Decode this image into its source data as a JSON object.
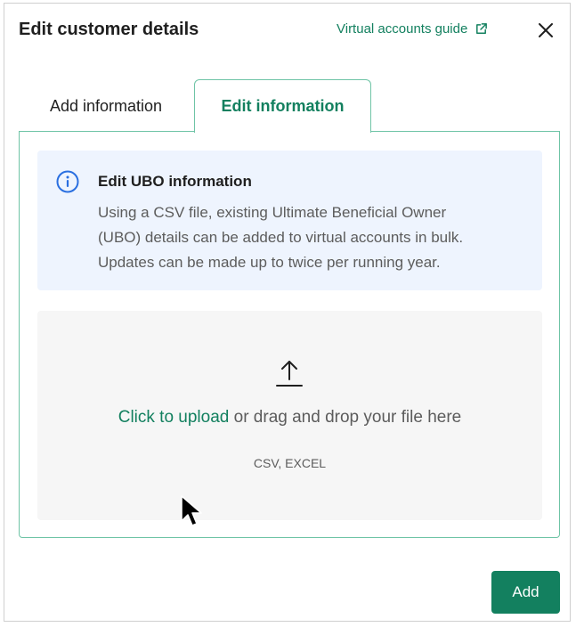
{
  "modal": {
    "title": "Edit customer details",
    "guide_link": "Virtual accounts guide",
    "guide_icon": "external-link-icon",
    "close_icon": "close-icon"
  },
  "tabs": [
    {
      "label": "Add information",
      "active": false
    },
    {
      "label": "Edit information",
      "active": true
    }
  ],
  "info": {
    "icon": "info-icon",
    "title": "Edit UBO information",
    "lines": [
      "Using a CSV file, existing Ultimate Beneficial Owner",
      "(UBO) details can be added to virtual accounts in bulk.",
      "Updates can be made up to twice per running year."
    ]
  },
  "upload": {
    "icon": "upload-icon",
    "link_text": "Click to upload",
    "rest_text": " or drag and drop your file here",
    "formats": "CSV, EXCEL"
  },
  "footer": {
    "add_label": "Add"
  },
  "colors": {
    "accent": "#13805f",
    "tab_border": "#6fc4a6",
    "info_bg": "#eef4fe",
    "info_icon": "#2a6fe0",
    "upload_bg": "#f6f6f6"
  }
}
